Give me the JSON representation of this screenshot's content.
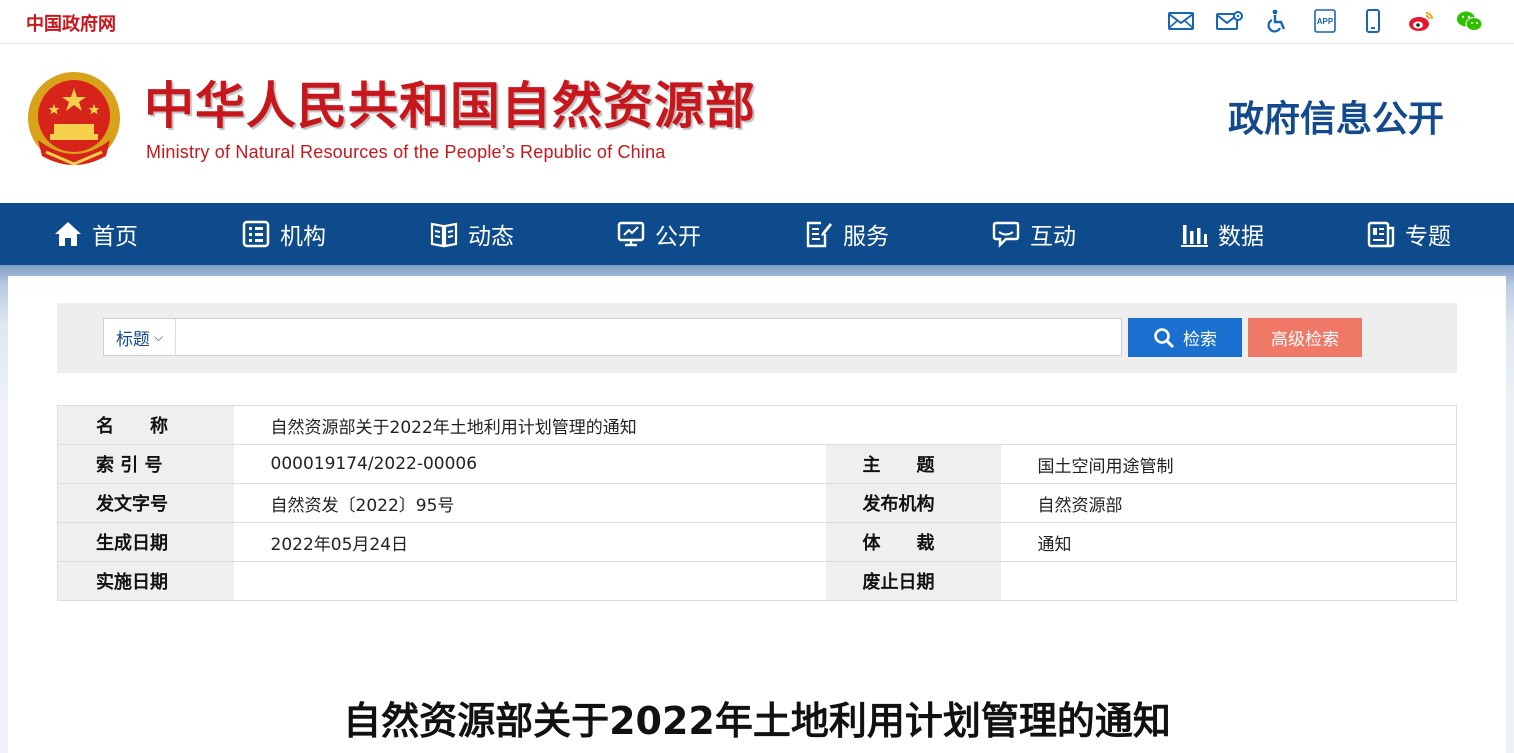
{
  "topbar": {
    "gov_link": "中国政府网",
    "tools": [
      {
        "icon": "mail-icon"
      },
      {
        "icon": "mail-settings-icon"
      },
      {
        "icon": "accessibility-icon"
      },
      {
        "icon": "app-icon",
        "label": "APP"
      },
      {
        "icon": "mobile-icon"
      },
      {
        "icon": "weibo-icon"
      },
      {
        "icon": "wechat-icon"
      }
    ]
  },
  "header": {
    "ministry_cn": "中华人民共和国自然资源部",
    "ministry_en": "Ministry of Natural Resources of the People’s Republic of China",
    "portal_title": "政府信息公开"
  },
  "nav": {
    "items": [
      {
        "label": "首页",
        "icon": "home-icon"
      },
      {
        "label": "机构",
        "icon": "org-icon"
      },
      {
        "label": "动态",
        "icon": "book-icon"
      },
      {
        "label": "公开",
        "icon": "monitor-icon"
      },
      {
        "label": "服务",
        "icon": "edit-doc-icon"
      },
      {
        "label": "互动",
        "icon": "chat-icon"
      },
      {
        "label": "数据",
        "icon": "bar-chart-icon"
      },
      {
        "label": "专题",
        "icon": "newspaper-icon"
      }
    ]
  },
  "search": {
    "scope": "标题",
    "value": "",
    "search_label": "检索",
    "advanced_label": "高级检索"
  },
  "info": {
    "name_label": "名　　称",
    "name_value": "自然资源部关于2022年土地利用计划管理的通知",
    "index_label": "索 引 号",
    "index_value": "000019174/2022-00006",
    "topic_label": "主　　题",
    "topic_value": "国土空间用途管制",
    "docno_label": "发文字号",
    "docno_value": "自然资发〔2022〕95号",
    "issuer_label": "发布机构",
    "issuer_value": "自然资源部",
    "created_label": "生成日期",
    "created_value": "2022年05月24日",
    "genre_label": "体　　裁",
    "genre_value": "通知",
    "effective_label": "实施日期",
    "effective_value": "",
    "expiry_label": "废止日期",
    "expiry_value": ""
  },
  "document": {
    "title": "自然资源部关于2022年土地利用计划管理的通知"
  },
  "colors": {
    "brand_red": "#c8161d",
    "nav_blue": "#0e4b8d",
    "search_blue": "#1b6fcf",
    "advanced_salmon": "#f07867"
  }
}
